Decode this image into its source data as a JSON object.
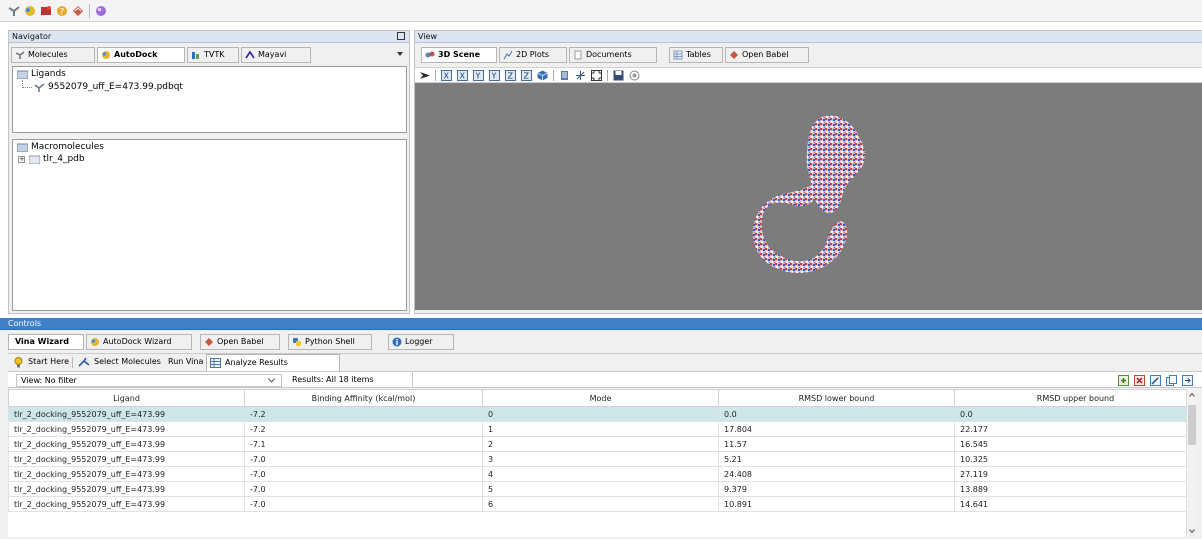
{
  "toolbar": {
    "icons": [
      "molecule-icon",
      "autodock-icon",
      "build-icon",
      "help-icon",
      "openbabel-icon",
      "sphere-icon"
    ]
  },
  "navigator": {
    "title": "Navigator",
    "tabs": [
      {
        "label": "Molecules",
        "icon": "molecule-icon"
      },
      {
        "label": "AutoDock",
        "icon": "autodock-icon"
      },
      {
        "label": "TVTK",
        "icon": "tvtk-icon"
      },
      {
        "label": "Mayavi",
        "icon": "mayavi-icon"
      }
    ],
    "active_tab": "AutoDock",
    "ligands": {
      "label": "Ligands",
      "items": [
        "9552079_uff_E=473.99.pdbqt"
      ]
    },
    "macromolecules": {
      "label": "Macromolecules",
      "items": [
        "tlr_4_pdb"
      ]
    }
  },
  "view": {
    "title": "View",
    "tabs": [
      {
        "label": "3D Scene",
        "icon": "scene-icon"
      },
      {
        "label": "2D Plots",
        "icon": "plot-icon"
      },
      {
        "label": "Documents",
        "icon": "document-icon"
      },
      {
        "label": "Tables",
        "icon": "table-icon"
      },
      {
        "label": "Open Babel",
        "icon": "openbabel-icon"
      }
    ],
    "active_tab": "3D Scene",
    "scene_background": "#7c7c7c"
  },
  "controls": {
    "title": "Controls",
    "tabs": [
      {
        "label": "Vina Wizard",
        "icon": ""
      },
      {
        "label": "AutoDock Wizard",
        "icon": "autodock-icon"
      },
      {
        "label": "Open Babel",
        "icon": "openbabel-icon"
      },
      {
        "label": "Python Shell",
        "icon": "python-icon"
      },
      {
        "label": "Logger",
        "icon": "info-icon"
      }
    ],
    "active_tab": "Vina Wizard",
    "steps": [
      {
        "label": "Start Here",
        "icon": "bulb-icon"
      },
      {
        "label": "Select Molecules",
        "icon": "select-icon"
      },
      {
        "label": "Run Vina",
        "icon": ""
      },
      {
        "label": "Analyze Results",
        "icon": "table-icon"
      }
    ],
    "active_step": "Analyze Results",
    "filter_label": "View:",
    "filter_value": "No filter",
    "results_label": "Results: All 18 items"
  },
  "results_table": {
    "columns": [
      "Ligand",
      "Binding Affinity (kcal/mol)",
      "Mode",
      "RMSD lower bound",
      "RMSD upper bound"
    ],
    "rows": [
      [
        "tlr_2_docking_9552079_uff_E=473.99",
        "-7.2",
        "0",
        "0.0",
        "0.0"
      ],
      [
        "tlr_2_docking_9552079_uff_E=473.99",
        "-7.2",
        "1",
        "17.804",
        "22.177"
      ],
      [
        "tlr_2_docking_9552079_uff_E=473.99",
        "-7.1",
        "2",
        "11.57",
        "16.545"
      ],
      [
        "tlr_2_docking_9552079_uff_E=473.99",
        "-7.0",
        "3",
        "5.21",
        "10.325"
      ],
      [
        "tlr_2_docking_9552079_uff_E=473.99",
        "-7.0",
        "4",
        "24.408",
        "27.119"
      ],
      [
        "tlr_2_docking_9552079_uff_E=473.99",
        "-7.0",
        "5",
        "9.379",
        "13.889"
      ],
      [
        "tlr_2_docking_9552079_uff_E=473.99",
        "-7.0",
        "6",
        "10.891",
        "14.641"
      ]
    ],
    "selected_row": 0
  },
  "colors": {
    "controls_header": "#3f80c6",
    "selected_row": "#cfe6e9",
    "scene_bg": "#7c7c7c"
  }
}
